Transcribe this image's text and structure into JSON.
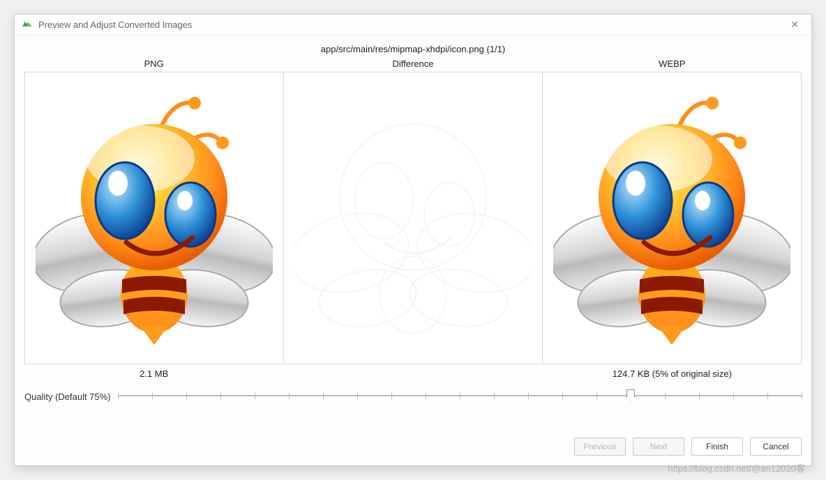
{
  "window": {
    "title": "Preview and Adjust Converted Images"
  },
  "path": "app/src/main/res/mipmap-xhdpi/icon.png (1/1)",
  "columns": {
    "left": "PNG",
    "middle": "Difference",
    "right": "WEBP"
  },
  "sizes": {
    "original": "2.1 MB",
    "converted": "124.7 KB (5% of original size)"
  },
  "quality": {
    "label": "Quality (Default 75%)",
    "value": 75,
    "min": 0,
    "max": 100
  },
  "buttons": {
    "previous": "Previous",
    "next": "Next",
    "finish": "Finish",
    "cancel": "Cancel"
  },
  "watermark": "https://blog.csdn.net/@an12020客"
}
